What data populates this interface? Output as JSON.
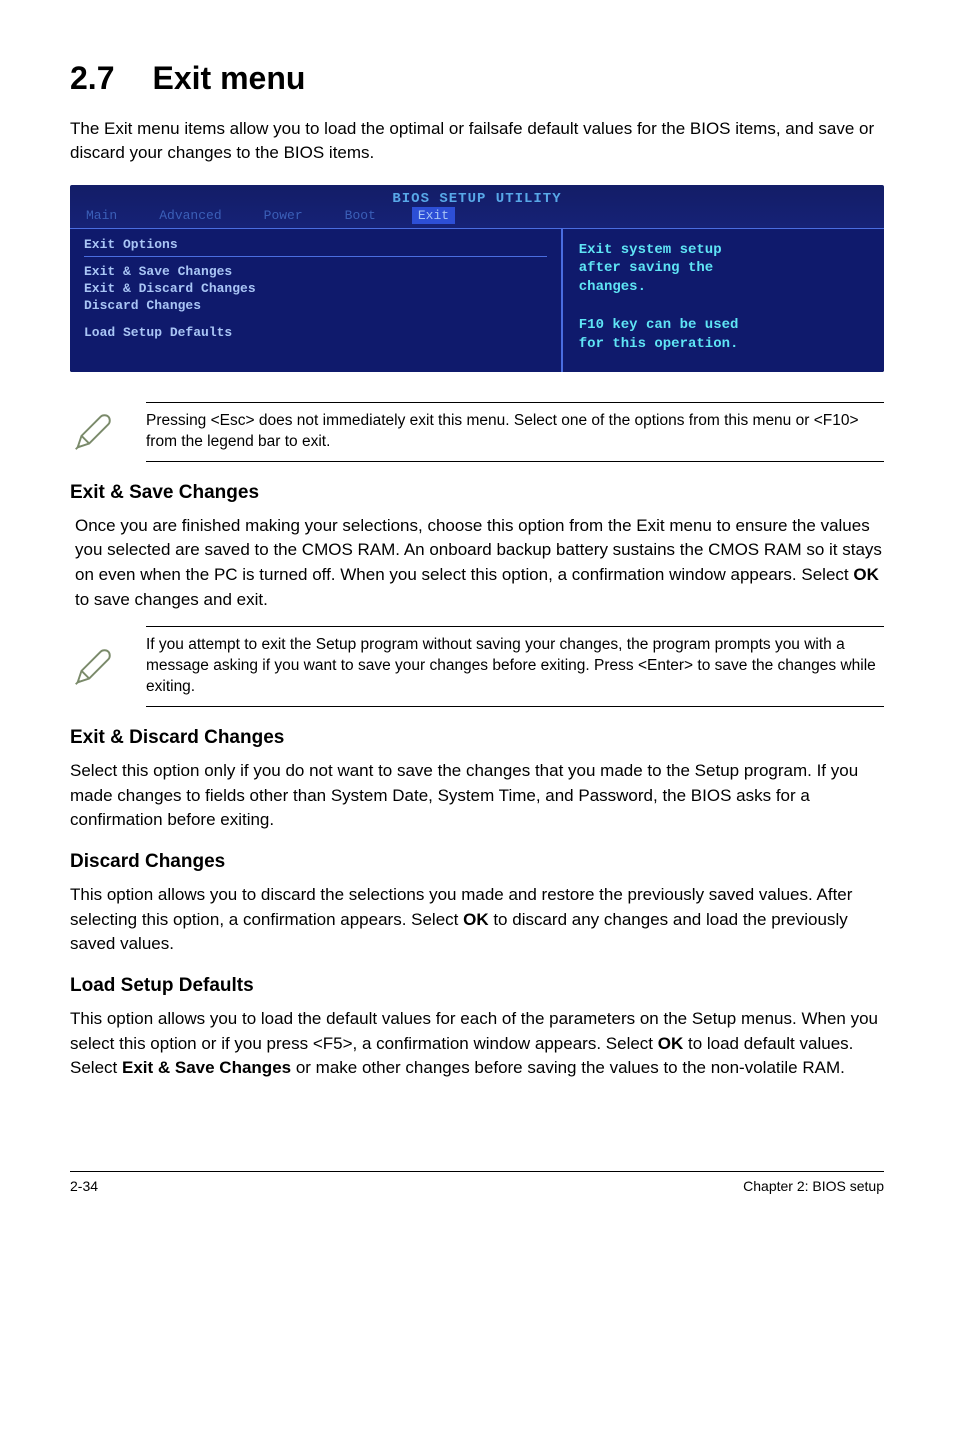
{
  "section": {
    "number": "2.7",
    "title": "Exit menu"
  },
  "intro": "The Exit menu items allow you to load the optimal or failsafe default values for the BIOS items, and save or discard your changes to the BIOS items.",
  "bios": {
    "header": "BIOS SETUP UTILITY",
    "tabs": [
      "Main",
      "Advanced",
      "Power",
      "Boot",
      "Exit"
    ],
    "left": {
      "title": "Exit Options",
      "items": [
        "Exit & Save Changes",
        "Exit & Discard Changes",
        "Discard Changes",
        "",
        "Load Setup Defaults"
      ]
    },
    "right": {
      "line1": "Exit system setup",
      "line2": "after saving the",
      "line3": "changes.",
      "line4": "",
      "line5": "F10 key can be used",
      "line6": "for this operation."
    }
  },
  "note1": "Pressing <Esc> does not immediately exit this menu. Select one of the options from this menu or <F10> from the legend bar to exit.",
  "h1": "Exit & Save Changes",
  "p1a": "Once you are finished making your selections, choose this option from the Exit menu to ensure the values you selected are saved to the CMOS RAM. An onboard backup battery sustains the CMOS RAM so it stays on even when the PC is turned off. When you select this option, a confirmation window appears. Select ",
  "p1b": "OK",
  "p1c": " to save changes and exit.",
  "note2": " If you attempt to exit the Setup program without saving your changes, the program prompts you with a message asking if you want to save your changes before exiting. Press <Enter>  to save the  changes while exiting.",
  "h2": "Exit & Discard Changes",
  "p2": "Select this option only if you do not want to save the changes that you  made to the Setup program. If you made changes to fields other than System Date, System Time, and Password, the BIOS asks for a confirmation before exiting.",
  "h3": "Discard Changes",
  "p3a": "This option allows you to discard the selections you made and restore the previously saved values. After selecting this option, a confirmation appears. Select ",
  "p3b": "OK",
  "p3c": " to discard any changes and load the previously saved values.",
  "h4": "Load Setup Defaults",
  "p4a": "This option allows you to load the default values for each of the parameters on the Setup menus. When you select this option or if you press <F5>, a confirmation window appears. Select ",
  "p4b": "OK",
  "p4c": " to load default values. Select ",
  "p4d": "Exit & Save Changes",
  "p4e": " or make other changes before saving the values to the non-volatile RAM.",
  "footer": {
    "left": "2-34",
    "right": "Chapter 2: BIOS setup"
  }
}
